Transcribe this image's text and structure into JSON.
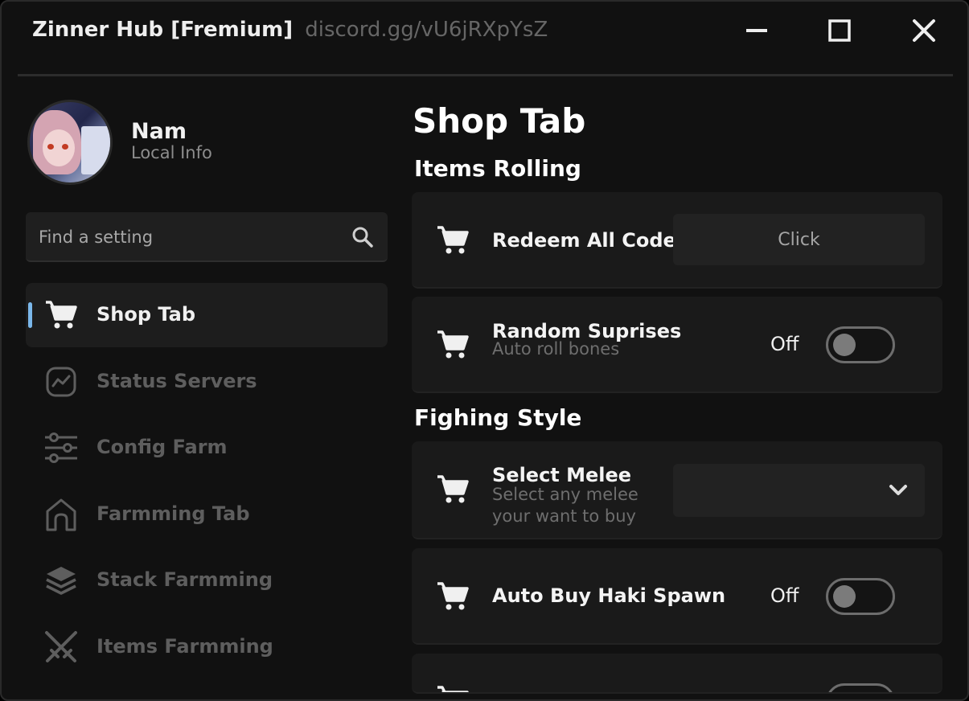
{
  "window": {
    "title": "Zinner Hub [Fremium]",
    "link": "discord.gg/vU6jRXpYsZ"
  },
  "profile": {
    "name": "Nam",
    "subtitle": "Local Info"
  },
  "search": {
    "placeholder": "Find a setting"
  },
  "sidebar": {
    "items": [
      {
        "label": "Shop Tab",
        "icon": "cart-icon",
        "active": true
      },
      {
        "label": "Status Servers",
        "icon": "activity-icon",
        "active": false
      },
      {
        "label": "Config Farm",
        "icon": "sliders-icon",
        "active": false
      },
      {
        "label": "Farmming Tab",
        "icon": "home-icon",
        "active": false
      },
      {
        "label": "Stack Farmming",
        "icon": "layers-icon",
        "active": false
      },
      {
        "label": "Items Farmming",
        "icon": "swords-icon",
        "active": false
      }
    ]
  },
  "main": {
    "title": "Shop Tab",
    "sections": [
      {
        "title": "Items Rolling",
        "rows": [
          {
            "title": "Redeem All Codes",
            "control": "button",
            "button_label": "Click"
          },
          {
            "title": "Random Suprises",
            "description": "Auto roll bones",
            "control": "toggle",
            "state": "Off"
          }
        ]
      },
      {
        "title": "Fighing Style",
        "rows": [
          {
            "title": "Select Melee",
            "description": "Select any melee your want to buy",
            "control": "dropdown",
            "selected": ""
          },
          {
            "title": "Auto Buy Haki Spawn",
            "control": "toggle",
            "state": "Off"
          }
        ]
      }
    ]
  },
  "colors": {
    "background": "#111111",
    "card": "#1a1a1a",
    "accent_indicator": "#7ab7ea",
    "muted_text": "#6e6e6e"
  }
}
